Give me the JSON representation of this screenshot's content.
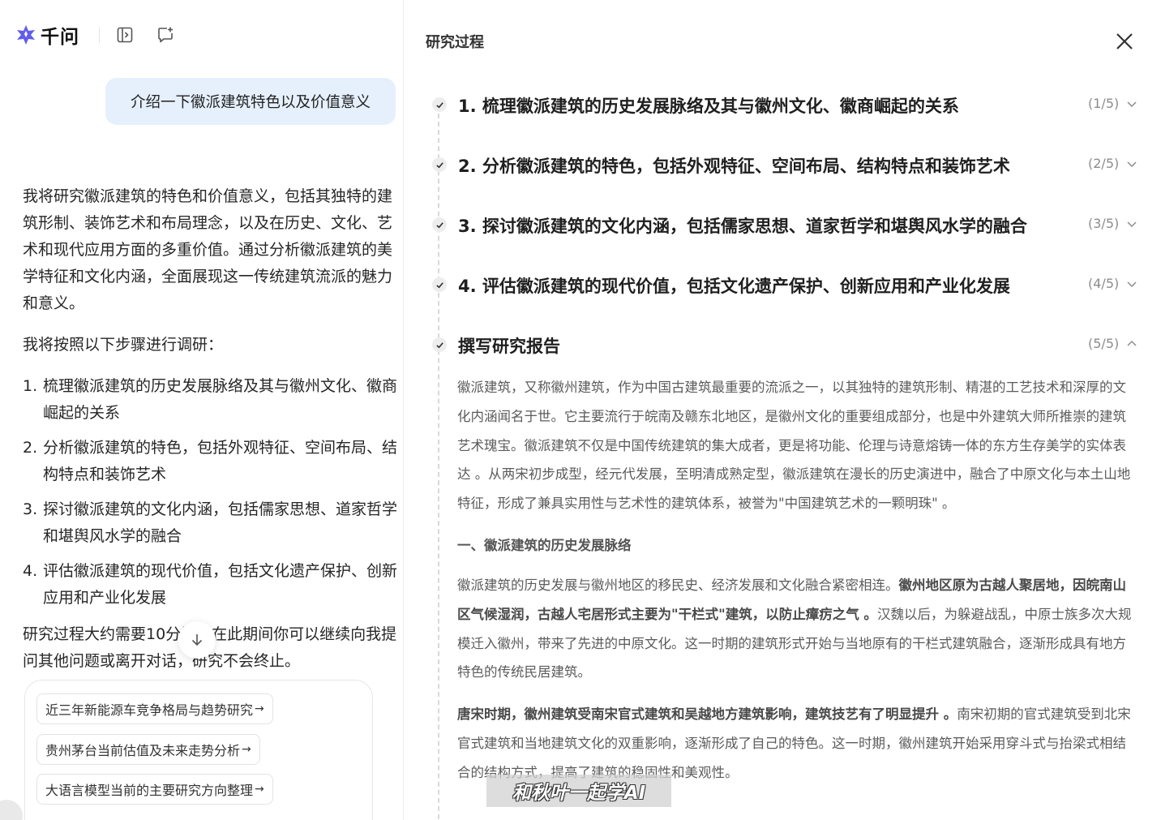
{
  "app": {
    "name": "千问"
  },
  "user_message": "介绍一下徽派建筑特色以及价值意义",
  "answer": {
    "intro": "我将研究徽派建筑的特色和价值意义，包括其独特的建筑形制、装饰艺术和布局理念，以及在历史、文化、艺术和现代应用方面的多重价值。通过分析徽派建筑的美学特征和文化内涵，全面展现这一传统建筑流派的魅力和意义。",
    "steps_intro": "我将按照以下步骤进行调研：",
    "steps": [
      {
        "num": "1.",
        "text": "梳理徽派建筑的历史发展脉络及其与徽州文化、徽商崛起的关系"
      },
      {
        "num": "2.",
        "text": "分析徽派建筑的特色，包括外观特征、空间布局、结构特点和装饰艺术"
      },
      {
        "num": "3.",
        "text": "探讨徽派建筑的文化内涵，包括儒家思想、道家哲学和堪舆风水学的融合"
      },
      {
        "num": "4.",
        "text": "评估徽派建筑的现代价值，包括文化遗产保护、创新应用和产业化发展"
      }
    ],
    "note": "研究过程大约需要10分钟，在此期间你可以继续向我提问其他问题或离开对话，研究不会终止。"
  },
  "suggestions": [
    {
      "label": "近三年新能源车竞争格局与趋势研究",
      "arrow": "→"
    },
    {
      "label": "贵州茅台当前估值及未来走势分析",
      "arrow": "→"
    },
    {
      "label": "大语言模型当前的主要研究方向整理",
      "arrow": "→"
    }
  ],
  "research_panel": {
    "title": "研究过程",
    "steps": [
      {
        "title": "1. 梳理徽派建筑的历史发展脉络及其与徽州文化、徽商崛起的关系",
        "count": "(1/5)",
        "expanded": false
      },
      {
        "title": "2. 分析徽派建筑的特色，包括外观特征、空间布局、结构特点和装饰艺术",
        "count": "(2/5)",
        "expanded": false
      },
      {
        "title": "3. 探讨徽派建筑的文化内涵，包括儒家思想、道家哲学和堪舆风水学的融合",
        "count": "(3/5)",
        "expanded": false
      },
      {
        "title": "4. 评估徽派建筑的现代价值，包括文化遗产保护、创新应用和产业化发展",
        "count": "(4/5)",
        "expanded": false
      },
      {
        "title": "撰写研究报告",
        "count": "(5/5)",
        "expanded": true
      }
    ],
    "report": {
      "p1": "徽派建筑，又称徽州建筑，作为中国古建筑最重要的流派之一，以其独特的建筑形制、精湛的工艺技术和深厚的文化内涵闻名于世。它主要流行于皖南及赣东北地区，是徽州文化的重要组成部分，也是中外建筑大师所推崇的建筑艺术瑰宝。徽派建筑不仅是中国传统建筑的集大成者，更是将功能、伦理与诗意熔铸一体的东方生存美学的实体表达 。从两宋初步成型，经元代发展，至明清成熟定型，徽派建筑在漫长的历史演进中，融合了中原文化与本土山地特征，形成了兼具实用性与艺术性的建筑体系，被誉为\"中国建筑艺术的一颗明珠\" 。",
      "section1": "一、徽派建筑的历史发展脉络",
      "p2_a": "徽派建筑的历史发展与徽州地区的移民史、经济发展和文化融合紧密相连。",
      "p2_b": "徽州地区原为古越人聚居地，因皖南山区气候湿润，古越人宅居形式主要为\"干栏式\"建筑，以防止瘴疠之气 。",
      "p2_c": "汉魏以后，为躲避战乱，中原士族多次大规模迁入徽州，带来了先进的中原文化。这一时期的建筑形式开始与当地原有的干栏式建筑融合，逐渐形成具有地方特色的传统民居建筑。",
      "p3_a": "唐宋时期，徽州建筑受南宋官式建筑和吴越地方建筑影响，建筑技艺有了明显提升 。",
      "p3_b": "南宋初期的官式建筑受到北宋官式建筑和当地建筑文化的双重影响，逐渐形成了自己的特色。这一时期，徽州建筑开始采用穿斗式与抬梁式相结合的结构方式，提高了建筑的稳固性和美观性。"
    }
  },
  "watermark": "和秋叶一起学AI",
  "colors": {
    "accent": "#615ced",
    "bubble": "#e6f0fd",
    "muted": "#8c8c8c"
  }
}
